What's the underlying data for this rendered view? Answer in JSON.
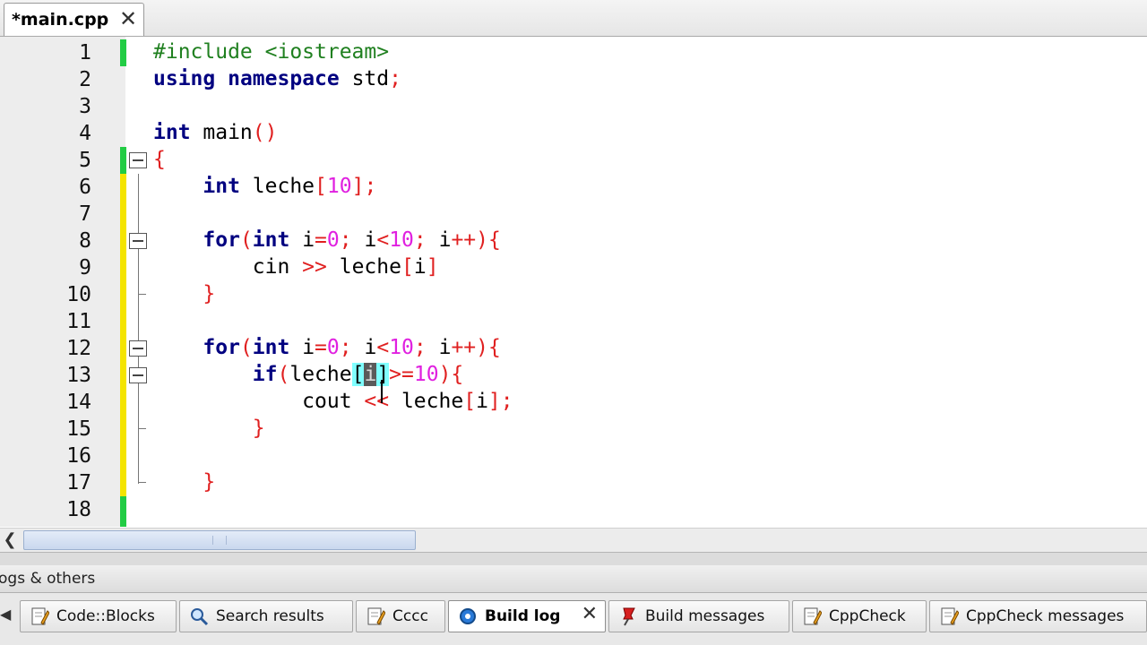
{
  "tab": {
    "title": "*main.cpp",
    "close": "✕"
  },
  "editor": {
    "line_numbers": [
      "1",
      "2",
      "3",
      "4",
      "5",
      "6",
      "7",
      "8",
      "9",
      "10",
      "11",
      "12",
      "13",
      "14",
      "15",
      "16",
      "17",
      "18"
    ]
  },
  "bottom_panel": {
    "title": "ogs & others",
    "tabs": [
      {
        "label": "Code::Blocks",
        "icon": "document-pencil-icon"
      },
      {
        "label": "Search results",
        "icon": "magnifier-icon"
      },
      {
        "label": "Cccc",
        "icon": "document-pencil-icon"
      },
      {
        "label": "Build log",
        "icon": "gear-blue-icon",
        "active": true
      },
      {
        "label": "Build messages",
        "icon": "pin-red-icon"
      },
      {
        "label": "CppCheck",
        "icon": "document-pencil-icon"
      },
      {
        "label": "CppCheck messages",
        "icon": "document-pencil-icon"
      }
    ],
    "close": "✕"
  },
  "colors": {
    "keyword": "#000080",
    "preprocessor": "#208020",
    "number": "#e020e0",
    "operator": "#e02020",
    "change_green": "#22cc44",
    "change_yellow": "#f4e400"
  }
}
